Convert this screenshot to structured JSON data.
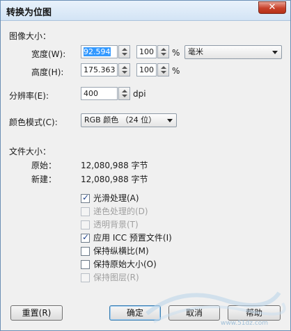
{
  "window": {
    "title": "转换为位图",
    "close_glyph": "✕"
  },
  "image_size": {
    "section_label": "图像大小：",
    "width_label": "宽度(W):",
    "width_value": "92.594",
    "width_percent": "100",
    "height_label": "高度(H):",
    "height_value": "175.363",
    "height_percent": "100",
    "percent_unit": "%",
    "unit_select": "毫米"
  },
  "resolution": {
    "label": "分辨率(E):",
    "value": "400",
    "unit": "dpi"
  },
  "color_mode": {
    "label": "颜色模式(C):",
    "selected": "RGB 颜色 （24 位）"
  },
  "file_size": {
    "section_label": "文件大小：",
    "original_label": "原始：",
    "original_value": "12,080,988 字节",
    "new_label": "新建：",
    "new_value": "12,080,988 字节"
  },
  "options": [
    {
      "label": "光滑处理(A)",
      "checked": true,
      "enabled": true
    },
    {
      "label": "递色处理的(D)",
      "checked": false,
      "enabled": false
    },
    {
      "label": "透明背景(T)",
      "checked": false,
      "enabled": false
    },
    {
      "label": "应用 ICC 预置文件(I)",
      "checked": true,
      "enabled": true
    },
    {
      "label": "保持纵横比(M)",
      "checked": false,
      "enabled": true
    },
    {
      "label": "保持原始大小(O)",
      "checked": false,
      "enabled": true
    },
    {
      "label": "保持图层(R)",
      "checked": false,
      "enabled": false
    }
  ],
  "buttons": {
    "reset": "重置(R)",
    "ok": "确定",
    "cancel": "取消",
    "help": "帮助"
  },
  "watermark_text": "www.51dz.com",
  "checkmark_glyph": "✓"
}
